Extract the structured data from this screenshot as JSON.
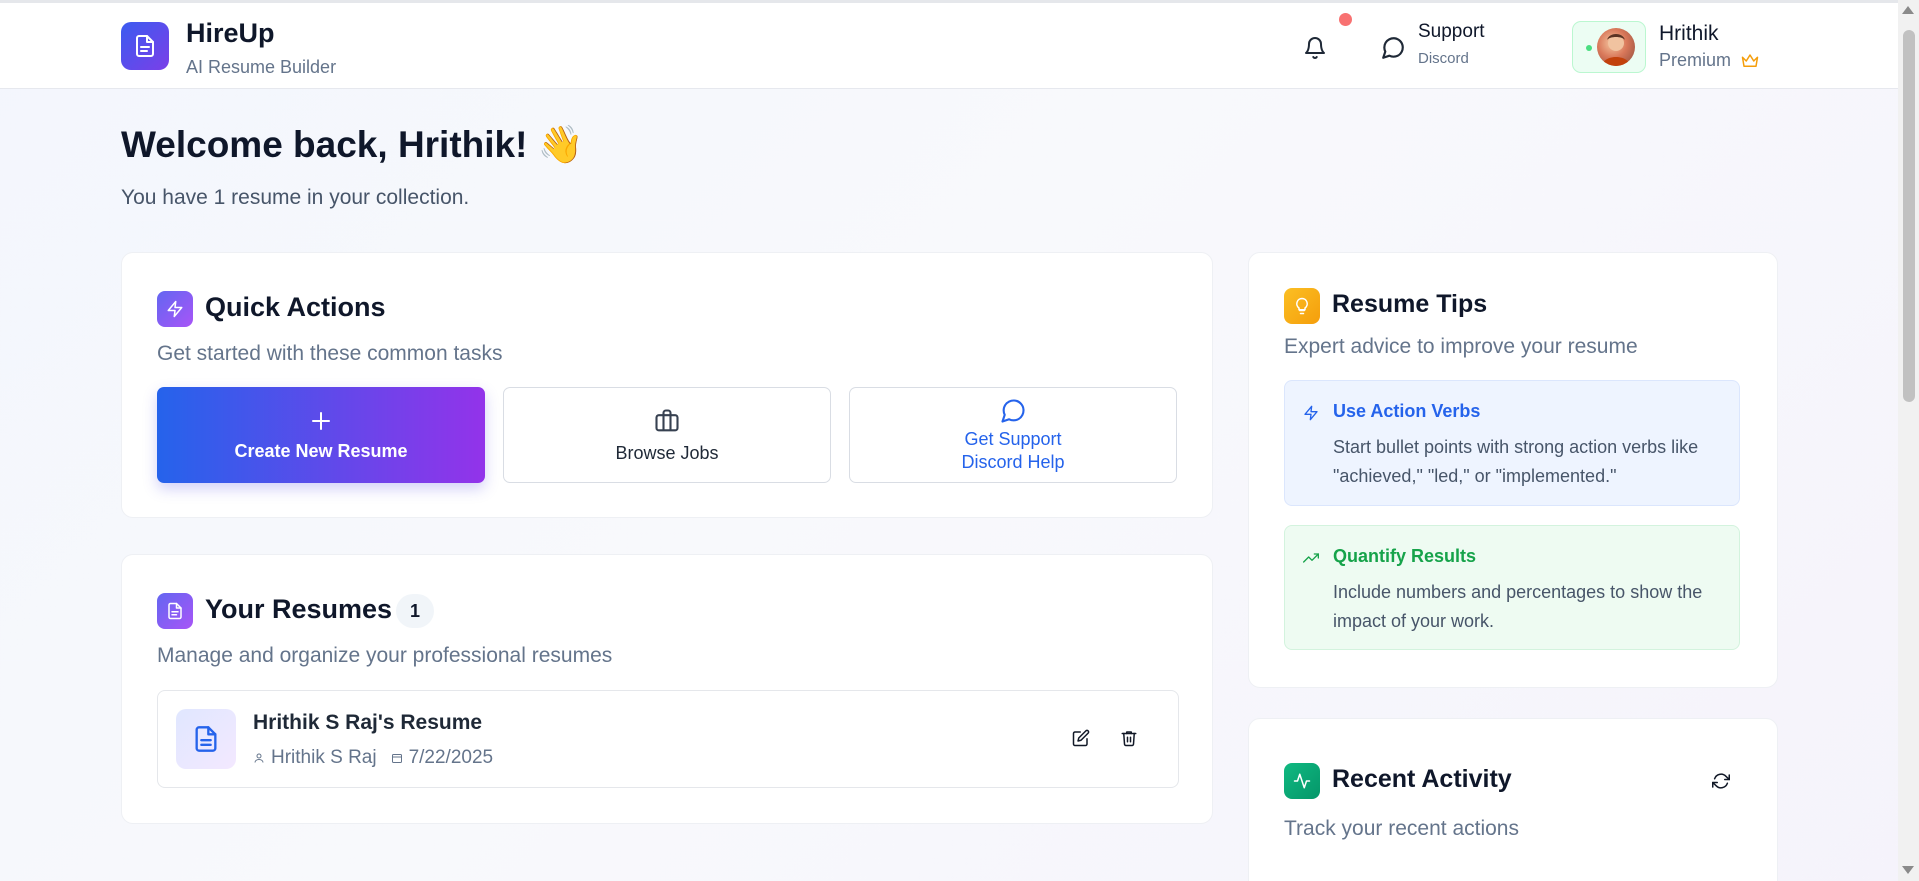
{
  "header": {
    "brand_title": "HireUp",
    "brand_subtitle": "AI Resume Builder",
    "support_title": "Support",
    "support_subtitle": "Discord",
    "user_name": "Hrithik",
    "user_plan": "Premium"
  },
  "welcome": {
    "title": "Welcome back, Hrithik! 👋",
    "subtitle": "You have 1 resume in your collection."
  },
  "quick_actions": {
    "title": "Quick Actions",
    "subtitle": "Get started with these common tasks",
    "create_label": "Create New Resume",
    "browse_label": "Browse Jobs",
    "support_label": "Get Support",
    "support_sub": "Discord Help"
  },
  "resumes": {
    "title": "Your Resumes",
    "count": "1",
    "subtitle": "Manage and organize your professional resumes",
    "items": [
      {
        "title": "Hrithik S Raj's Resume",
        "owner": "Hrithik S Raj",
        "date": "7/22/2025"
      }
    ]
  },
  "tips": {
    "title": "Resume Tips",
    "subtitle": "Expert advice to improve your resume",
    "items": [
      {
        "title": "Use Action Verbs",
        "body": "Start bullet points with strong action verbs like \"achieved,\" \"led,\" or \"implemented.\""
      },
      {
        "title": "Quantify Results",
        "body": "Include numbers and percentages to show the impact of your work."
      }
    ]
  },
  "activity": {
    "title": "Recent Activity",
    "subtitle": "Track your recent actions"
  },
  "colors": {
    "brand_gradient_start": "#2563eb",
    "brand_gradient_end": "#9333ea",
    "tip_blue": "#2563eb",
    "tip_green": "#16a34a",
    "tips_icon": "#f59e0b",
    "activity_icon": "#10b981"
  }
}
